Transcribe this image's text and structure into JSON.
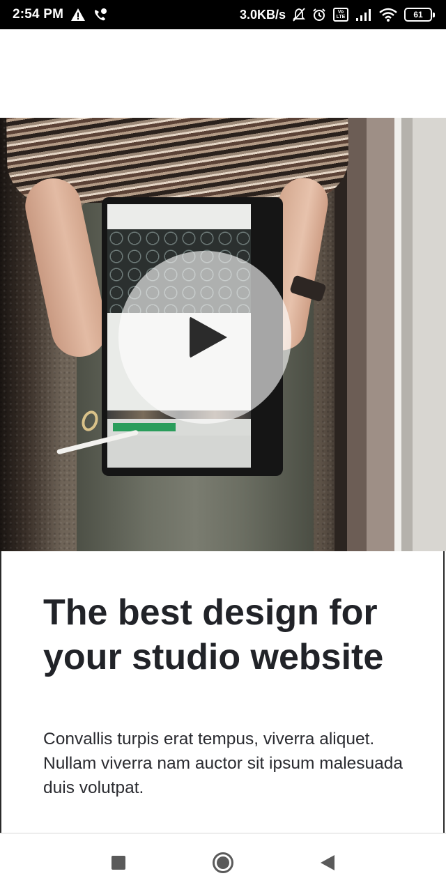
{
  "status_bar": {
    "time": "2:54 PM",
    "network_speed": "3.0KB/s",
    "battery_level": "61",
    "icons": [
      "warning-icon",
      "missed-call-icon",
      "mute-bell-icon",
      "alarm-icon",
      "volte-icon",
      "signal-icon",
      "wifi-icon",
      "battery-icon"
    ]
  },
  "hero": {
    "image_subject": "person holding tablet",
    "play_icon": "play-icon"
  },
  "content": {
    "headline": "The best design for your studio website",
    "body": "Convallis turpis erat tempus, viverra aliquet. Nullam viverra nam auctor sit ipsum malesuada duis volutpat."
  },
  "nav_bar": {
    "icons": [
      "recents-icon",
      "home-icon",
      "back-icon"
    ]
  },
  "colors": {
    "status_bar_bg": "#000000",
    "headline_text": "#212328",
    "body_text": "#2a2b30",
    "nav_icon": "#5a5a5a"
  }
}
